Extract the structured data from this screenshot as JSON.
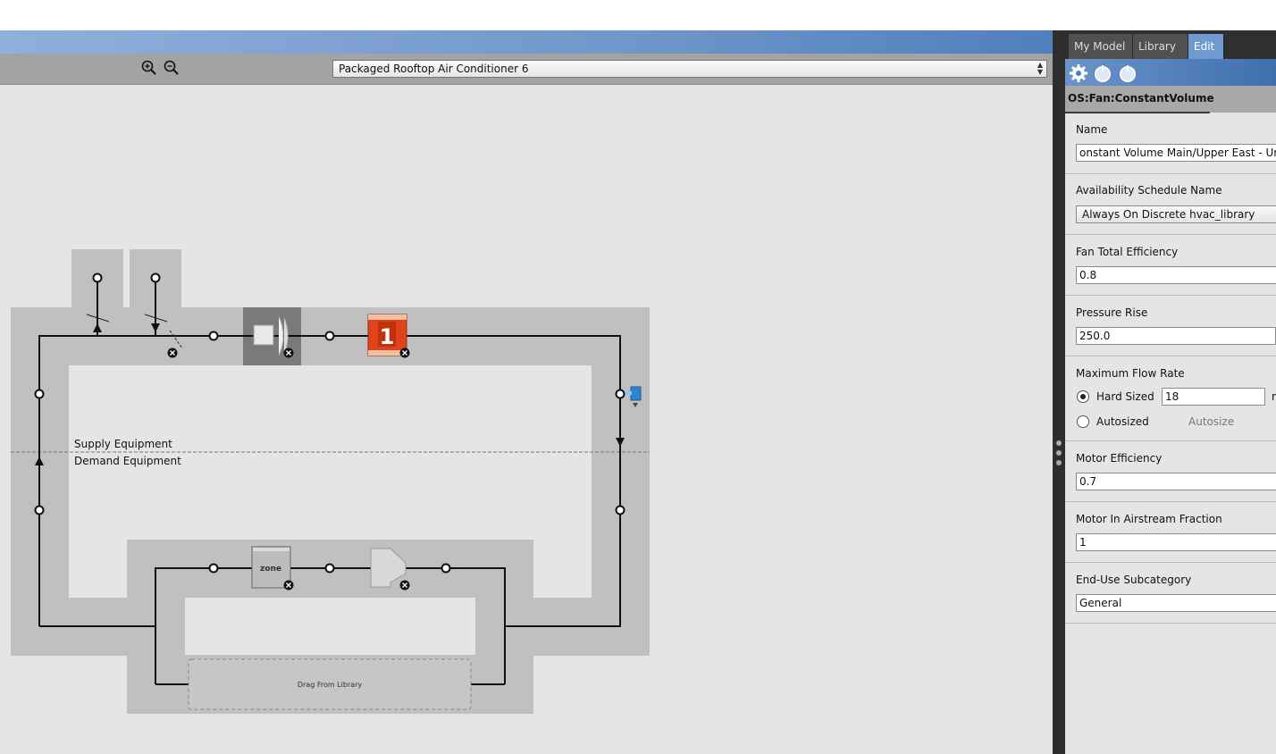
{
  "toolbar": {
    "zoom_in_icon": "zoom-in-icon",
    "zoom_out_icon": "zoom-out-icon",
    "system_select_value": "Packaged Rooftop Air Conditioner 6"
  },
  "diagram": {
    "supply_label": "Supply Equipment",
    "demand_label": "Demand Equipment",
    "zone_label": "zone",
    "coil_number": "1",
    "drop_zone_label": "Drag From Library"
  },
  "tabs": [
    {
      "label": "My Model",
      "active": false
    },
    {
      "label": "Library",
      "active": false
    },
    {
      "label": "Edit",
      "active": true
    }
  ],
  "inspector": {
    "object_type": "OS:Fan:ConstantVolume",
    "name_label": "Name",
    "name_value": "onstant Volume Main/Upper East - Unit",
    "availability_label": "Availability Schedule Name",
    "availability_value": "Always On Discrete hvac_library",
    "fan_eff_label": "Fan Total Efficiency",
    "fan_eff_value": "0.8",
    "pressure_label": "Pressure Rise",
    "pressure_value": "250.0",
    "max_flow_label": "Maximum Flow Rate",
    "hard_sized_label": "Hard Sized",
    "hard_sized_value": "18",
    "unit_fragment": "r",
    "autosized_label": "Autosized",
    "autosize_button": "Autosize",
    "motor_eff_label": "Motor Efficiency",
    "motor_eff_value": "0.7",
    "motor_air_label": "Motor In Airstream Fraction",
    "motor_air_value": "1",
    "enduse_label": "End-Use Subcategory",
    "enduse_value": "General"
  },
  "colors": {
    "title_gradient_start": "#8fb0dc",
    "tab_active": "#6e9ad0",
    "coil_red": "#e0441c"
  }
}
